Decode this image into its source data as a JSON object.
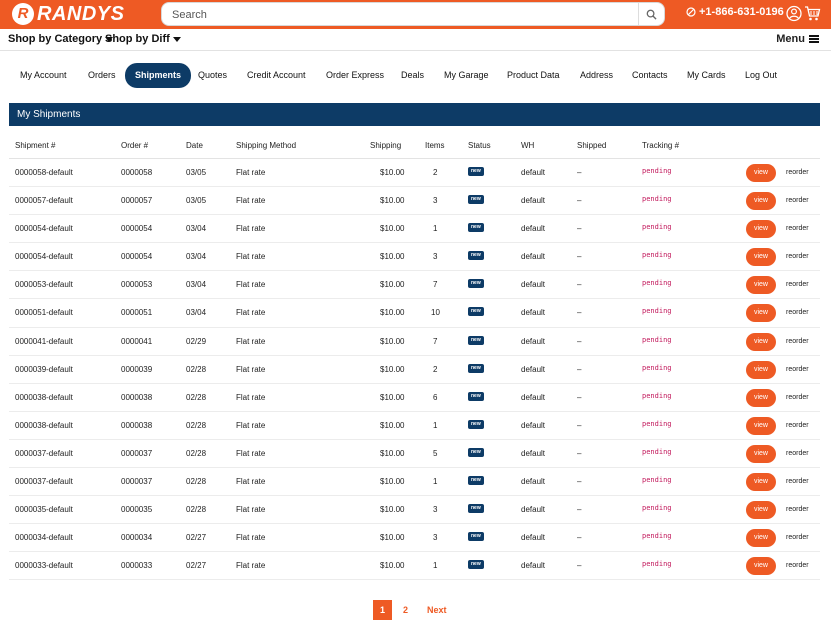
{
  "header": {
    "logo_badge": "R",
    "logo_text": "RANDYS",
    "search_placeholder": "Search",
    "phone": "+1-866-631-0196"
  },
  "subnav": {
    "shop_by_category": "Shop by Category",
    "shop_by_diff": "Shop by Diff",
    "menu": "Menu"
  },
  "tabs": [
    {
      "label": "My Account",
      "active": false
    },
    {
      "label": "Orders",
      "active": false
    },
    {
      "label": "Shipments",
      "active": true
    },
    {
      "label": "Quotes",
      "active": false
    },
    {
      "label": "Credit Account",
      "active": false
    },
    {
      "label": "Order Express",
      "active": false
    },
    {
      "label": "Deals",
      "active": false
    },
    {
      "label": "My Garage",
      "active": false
    },
    {
      "label": "Product Data",
      "active": false
    },
    {
      "label": "Address",
      "active": false
    },
    {
      "label": "Contacts",
      "active": false
    },
    {
      "label": "My Cards",
      "active": false
    },
    {
      "label": "Log Out",
      "active": false
    }
  ],
  "panel": {
    "title": "My Shipments"
  },
  "table": {
    "headers": [
      "Shipment #",
      "Order #",
      "Date",
      "Shipping Method",
      "Shipping",
      "Items",
      "Status",
      "WH",
      "Shipped",
      "Tracking #"
    ],
    "view_label": "view",
    "reorder_label": "reorder",
    "rows": [
      {
        "shipment": "0000058-default",
        "order": "0000058",
        "date": "03/05",
        "method": "Flat rate",
        "shipping": "$10.00",
        "items": "2",
        "status": "new",
        "wh": "default",
        "shipped": "–",
        "tracking": "pending"
      },
      {
        "shipment": "0000057-default",
        "order": "0000057",
        "date": "03/05",
        "method": "Flat rate",
        "shipping": "$10.00",
        "items": "3",
        "status": "new",
        "wh": "default",
        "shipped": "–",
        "tracking": "pending"
      },
      {
        "shipment": "0000054-default",
        "order": "0000054",
        "date": "03/04",
        "method": "Flat rate",
        "shipping": "$10.00",
        "items": "1",
        "status": "new",
        "wh": "default",
        "shipped": "–",
        "tracking": "pending"
      },
      {
        "shipment": "0000054-default",
        "order": "0000054",
        "date": "03/04",
        "method": "Flat rate",
        "shipping": "$10.00",
        "items": "3",
        "status": "new",
        "wh": "default",
        "shipped": "–",
        "tracking": "pending"
      },
      {
        "shipment": "0000053-default",
        "order": "0000053",
        "date": "03/04",
        "method": "Flat rate",
        "shipping": "$10.00",
        "items": "7",
        "status": "new",
        "wh": "default",
        "shipped": "–",
        "tracking": "pending"
      },
      {
        "shipment": "0000051-default",
        "order": "0000051",
        "date": "03/04",
        "method": "Flat rate",
        "shipping": "$10.00",
        "items": "10",
        "status": "new",
        "wh": "default",
        "shipped": "–",
        "tracking": "pending"
      },
      {
        "shipment": "0000041-default",
        "order": "0000041",
        "date": "02/29",
        "method": "Flat rate",
        "shipping": "$10.00",
        "items": "7",
        "status": "new",
        "wh": "default",
        "shipped": "–",
        "tracking": "pending"
      },
      {
        "shipment": "0000039-default",
        "order": "0000039",
        "date": "02/28",
        "method": "Flat rate",
        "shipping": "$10.00",
        "items": "2",
        "status": "new",
        "wh": "default",
        "shipped": "–",
        "tracking": "pending"
      },
      {
        "shipment": "0000038-default",
        "order": "0000038",
        "date": "02/28",
        "method": "Flat rate",
        "shipping": "$10.00",
        "items": "6",
        "status": "new",
        "wh": "default",
        "shipped": "–",
        "tracking": "pending"
      },
      {
        "shipment": "0000038-default",
        "order": "0000038",
        "date": "02/28",
        "method": "Flat rate",
        "shipping": "$10.00",
        "items": "1",
        "status": "new",
        "wh": "default",
        "shipped": "–",
        "tracking": "pending"
      },
      {
        "shipment": "0000037-default",
        "order": "0000037",
        "date": "02/28",
        "method": "Flat rate",
        "shipping": "$10.00",
        "items": "5",
        "status": "new",
        "wh": "default",
        "shipped": "–",
        "tracking": "pending"
      },
      {
        "shipment": "0000037-default",
        "order": "0000037",
        "date": "02/28",
        "method": "Flat rate",
        "shipping": "$10.00",
        "items": "1",
        "status": "new",
        "wh": "default",
        "shipped": "–",
        "tracking": "pending"
      },
      {
        "shipment": "0000035-default",
        "order": "0000035",
        "date": "02/28",
        "method": "Flat rate",
        "shipping": "$10.00",
        "items": "3",
        "status": "new",
        "wh": "default",
        "shipped": "–",
        "tracking": "pending"
      },
      {
        "shipment": "0000034-default",
        "order": "0000034",
        "date": "02/27",
        "method": "Flat rate",
        "shipping": "$10.00",
        "items": "3",
        "status": "new",
        "wh": "default",
        "shipped": "–",
        "tracking": "pending"
      },
      {
        "shipment": "0000033-default",
        "order": "0000033",
        "date": "02/27",
        "method": "Flat rate",
        "shipping": "$10.00",
        "items": "1",
        "status": "new",
        "wh": "default",
        "shipped": "–",
        "tracking": "pending"
      }
    ]
  },
  "pagination": {
    "pages": [
      "1",
      "2"
    ],
    "current": "1",
    "next": "Next"
  },
  "colors": {
    "brand_orange": "#ee5a24",
    "navy": "#0d3b66",
    "tracking_pink": "#c2185b"
  },
  "icons": [
    "logo-icon",
    "search-icon",
    "phone-icon",
    "user-icon",
    "cart-icon",
    "chevron-down-icon",
    "menu-icon"
  ]
}
